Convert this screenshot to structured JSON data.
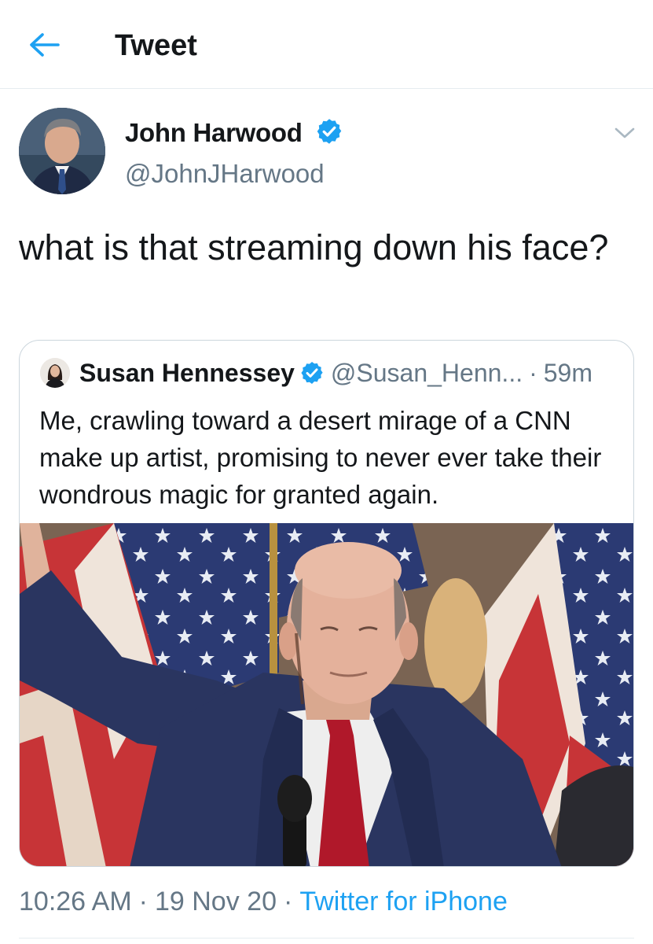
{
  "topbar": {
    "back_icon": "arrow-left-icon",
    "title": "Tweet"
  },
  "tweet": {
    "author": {
      "name": "John Harwood",
      "handle": "@JohnJHarwood",
      "verified": true
    },
    "text": "what is that streaming down his face?",
    "quoted": {
      "author_name": "Susan Hennessey",
      "verified": true,
      "handle": "@Susan_Henn...",
      "separator": "·",
      "time": "59m",
      "text": "Me, crawling toward a desert mirage of a CNN make up artist, promising to never ever take their wondrous magic for granted again."
    },
    "timestamp": {
      "time": "10:26 AM",
      "date": "19 Nov 20",
      "separator": "·",
      "source": "Twitter for iPhone"
    }
  },
  "colors": {
    "twitter_blue": "#1da1f2",
    "secondary_text": "#657786",
    "divider": "#e6ecf0",
    "quote_border": "#ccd6dd"
  }
}
